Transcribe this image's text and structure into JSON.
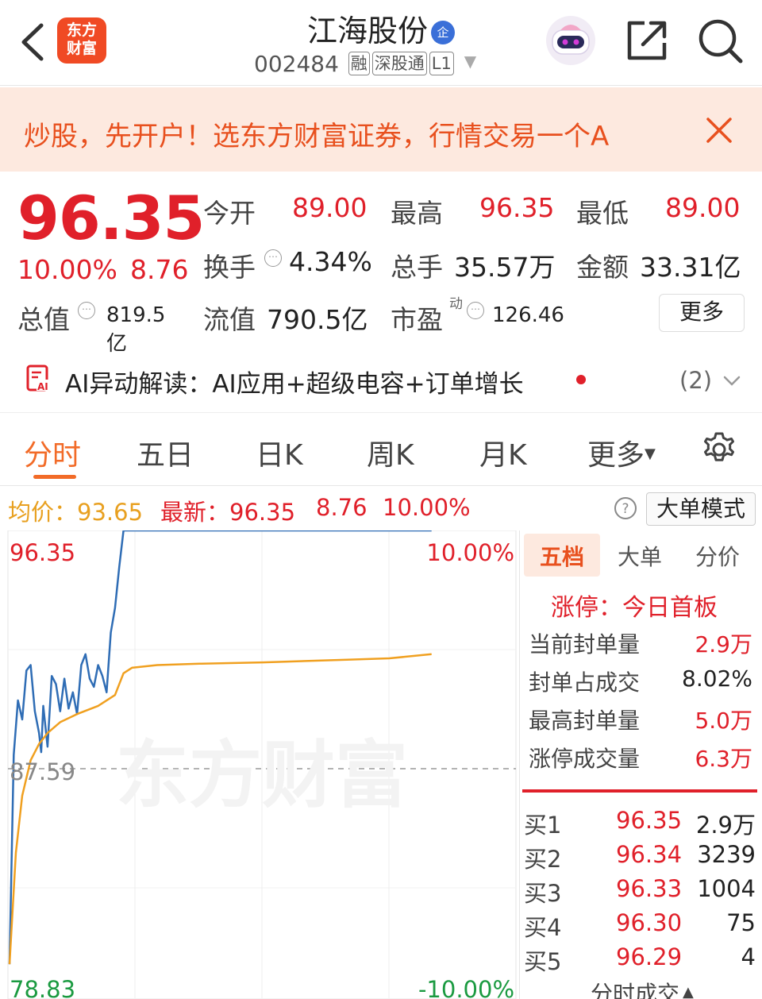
{
  "header": {
    "logo_text": "东方财富",
    "stock_name": "江海股份",
    "stock_badge": "企",
    "stock_code": "002484",
    "tags": [
      "融",
      "深股通",
      "L1"
    ]
  },
  "banner": {
    "text": "炒股，先开户！选东方财富证券，行情交易一个A"
  },
  "quote": {
    "price": "96.35",
    "change_pct": "10.00%",
    "change_amt": "8.76",
    "open_label": "今开",
    "open": "89.00",
    "high_label": "最高",
    "high": "96.35",
    "low_label": "最低",
    "low": "89.00",
    "turnover_label": "换手",
    "turnover": "4.34%",
    "volume_label": "总手",
    "volume": "35.57万",
    "amount_label": "金额",
    "amount": "33.31亿",
    "mktcap_label": "总值",
    "mktcap": "819.5亿",
    "float_label": "流值",
    "float": "790.5亿",
    "pe_label": "市盈",
    "pe_sup": "动",
    "pe": "126.46",
    "more_label": "更多"
  },
  "ai": {
    "text": "AI异动解读：AI应用+超级电容+订单增长",
    "count": "(2)"
  },
  "tabs": [
    "分时",
    "五日",
    "日K",
    "周K",
    "月K",
    "更多"
  ],
  "chart_head": {
    "avg_label": "均价：",
    "avg": "93.65",
    "latest_label": "最新：",
    "latest": "96.35",
    "chg": "8.76",
    "pct": "10.00%",
    "mode_label": "大单模式"
  },
  "chart_data": {
    "type": "line",
    "y_axis_labels": {
      "top": "96.35",
      "mid": "87.59",
      "bottom": "78.83",
      "top_pct": "10.00%",
      "bottom_pct": "-10.00%"
    },
    "ylim": [
      78.83,
      96.35
    ],
    "prev_close": 87.59,
    "watermark": "东方财富",
    "series": [
      {
        "color": "#2f6db5",
        "points": [
          [
            0,
            80.4
          ],
          [
            2,
            88.1
          ],
          [
            4,
            90.1
          ],
          [
            6,
            89.4
          ],
          [
            8,
            91.2
          ],
          [
            10,
            91.4
          ],
          [
            12,
            89.7
          ],
          [
            14,
            88.9
          ],
          [
            15,
            88.2
          ],
          [
            16,
            89.9
          ],
          [
            18,
            88.4
          ],
          [
            20,
            91.0
          ],
          [
            22,
            90.7
          ],
          [
            24,
            89.7
          ],
          [
            26,
            90.9
          ],
          [
            28,
            89.8
          ],
          [
            30,
            90.4
          ],
          [
            32,
            89.6
          ],
          [
            34,
            91.4
          ],
          [
            36,
            91.8
          ],
          [
            38,
            90.9
          ],
          [
            40,
            90.6
          ],
          [
            42,
            91.4
          ],
          [
            44,
            91.0
          ],
          [
            46,
            90.4
          ],
          [
            48,
            92.6
          ],
          [
            50,
            93.5
          ],
          [
            52,
            95.0
          ],
          [
            54,
            96.35
          ],
          [
            60,
            96.35
          ],
          [
            90,
            96.35
          ],
          [
            150,
            96.35
          ],
          [
            200,
            96.35
          ]
        ]
      },
      {
        "color": "#f0a020",
        "points": [
          [
            0,
            80.4
          ],
          [
            3,
            84.5
          ],
          [
            6,
            86.6
          ],
          [
            10,
            87.9
          ],
          [
            14,
            88.5
          ],
          [
            18,
            88.9
          ],
          [
            24,
            89.3
          ],
          [
            32,
            89.6
          ],
          [
            42,
            89.9
          ],
          [
            50,
            90.3
          ],
          [
            54,
            91.1
          ],
          [
            58,
            91.3
          ],
          [
            70,
            91.4
          ],
          [
            90,
            91.45
          ],
          [
            120,
            91.5
          ],
          [
            160,
            91.6
          ],
          [
            180,
            91.65
          ],
          [
            200,
            91.8
          ]
        ]
      }
    ],
    "x_total": 240
  },
  "panel": {
    "tabs": [
      "五档",
      "大单",
      "分价"
    ],
    "limit_label": "涨停：今日首板",
    "seal": [
      {
        "label": "当前封单量",
        "value": "2.9万"
      },
      {
        "label": "封单占成交",
        "value": "8.02%"
      },
      {
        "label": "最高封单量",
        "value": "5.0万"
      },
      {
        "label": "涨停成交量",
        "value": "6.3万"
      }
    ],
    "book": [
      {
        "label": "买1",
        "price": "96.35",
        "vol": "2.9万"
      },
      {
        "label": "买2",
        "price": "96.34",
        "vol": "3239"
      },
      {
        "label": "买3",
        "price": "96.33",
        "vol": "1004"
      },
      {
        "label": "买4",
        "price": "96.30",
        "vol": "75"
      },
      {
        "label": "买5",
        "price": "96.29",
        "vol": "4"
      }
    ],
    "footer": "分时成交"
  },
  "colors": {
    "up": "#e0202a",
    "accent": "#f26b28",
    "price_line": "#2f6db5",
    "avg_line": "#f0a020"
  }
}
